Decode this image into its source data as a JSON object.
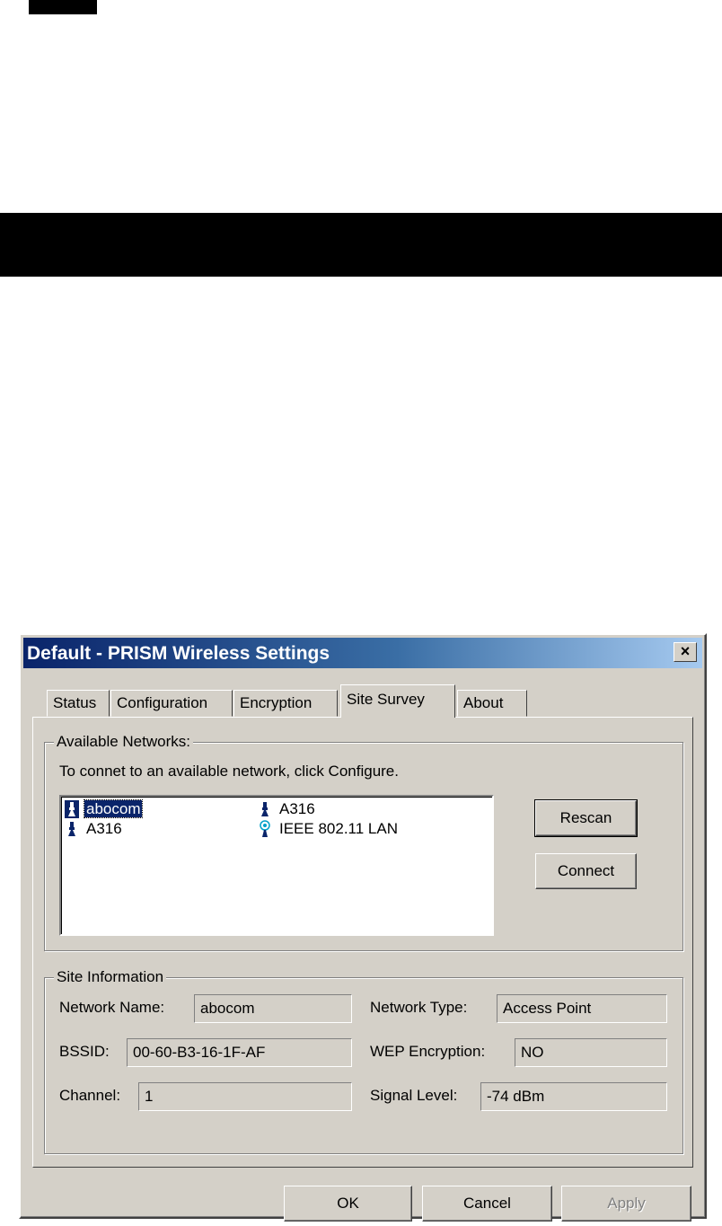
{
  "dialog": {
    "title": "Default - PRISM Wireless Settings",
    "close_label": "×"
  },
  "tabs": [
    {
      "label": "Status"
    },
    {
      "label": "Configuration"
    },
    {
      "label": "Encryption"
    },
    {
      "label": "Site Survey",
      "active": true
    },
    {
      "label": "About"
    }
  ],
  "available_networks": {
    "group_label": "Available Networks:",
    "instruction": "To connet to an available network, click Configure.",
    "items": [
      {
        "name": "abocom",
        "icon": "access-point-icon",
        "selected": true
      },
      {
        "name": "A316",
        "icon": "access-point-icon"
      },
      {
        "name": "A316",
        "icon": "access-point-icon"
      },
      {
        "name": "IEEE 802.11 LAN",
        "icon": "adhoc-network-icon"
      }
    ],
    "rescan_label": "Rescan",
    "connect_label": "Connect"
  },
  "site_information": {
    "group_label": "Site Information",
    "network_name_label": "Network Name:",
    "network_name_value": "abocom",
    "network_type_label": "Network Type:",
    "network_type_value": "Access Point",
    "bssid_label": "BSSID:",
    "bssid_value": "00-60-B3-16-1F-AF",
    "wep_label": "WEP Encryption:",
    "wep_value": "NO",
    "channel_label": "Channel:",
    "channel_value": "1",
    "signal_label": "Signal Level:",
    "signal_value": "-74 dBm"
  },
  "footer": {
    "ok_label": "OK",
    "cancel_label": "Cancel",
    "apply_label": "Apply"
  },
  "colors": {
    "title_active": "#0a246a",
    "face": "#d4d0c8",
    "selection": "#0a246a"
  }
}
